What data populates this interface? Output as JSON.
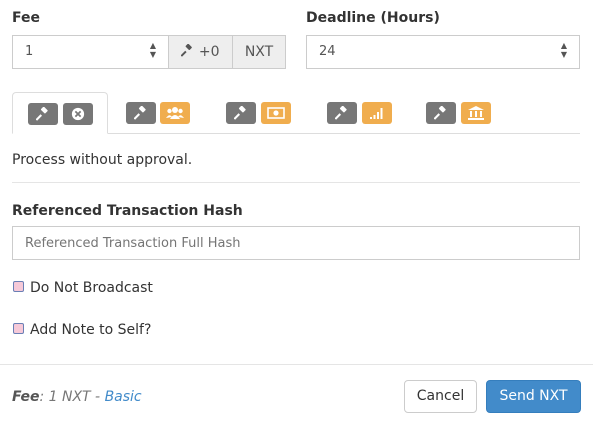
{
  "fee": {
    "label": "Fee",
    "value": "1",
    "addon_value": "+0",
    "currency": "NXT"
  },
  "deadline": {
    "label": "Deadline (Hours)",
    "value": "24"
  },
  "tabs": [
    {
      "icons": [
        "gavel-icon",
        "close-circle-icon"
      ],
      "badge_color": "#777777",
      "active": true
    },
    {
      "icons": [
        "gavel-icon",
        "users-icon"
      ],
      "badge_color": "#f0ad4e",
      "active": false
    },
    {
      "icons": [
        "gavel-icon",
        "money-icon"
      ],
      "badge_color": "#f0ad4e",
      "active": false
    },
    {
      "icons": [
        "gavel-icon",
        "signal-icon"
      ],
      "badge_color": "#f0ad4e",
      "active": false
    },
    {
      "icons": [
        "gavel-icon",
        "bank-icon"
      ],
      "badge_color": "#f0ad4e",
      "active": false
    }
  ],
  "approval_text": "Process without approval.",
  "referenced_hash": {
    "label": "Referenced Transaction Hash",
    "placeholder": "Referenced Transaction Full Hash"
  },
  "do_not_broadcast": "Do Not Broadcast",
  "add_note": "Add Note to Self?",
  "footer": {
    "fee_label": "Fee",
    "fee_value": ": 1 NXT - ",
    "fee_link": "Basic",
    "cancel": "Cancel",
    "send": "Send NXT"
  },
  "colors": {
    "primary": "#428bca",
    "link": "#428bca",
    "orange": "#f0ad4e",
    "gray": "#777777"
  }
}
